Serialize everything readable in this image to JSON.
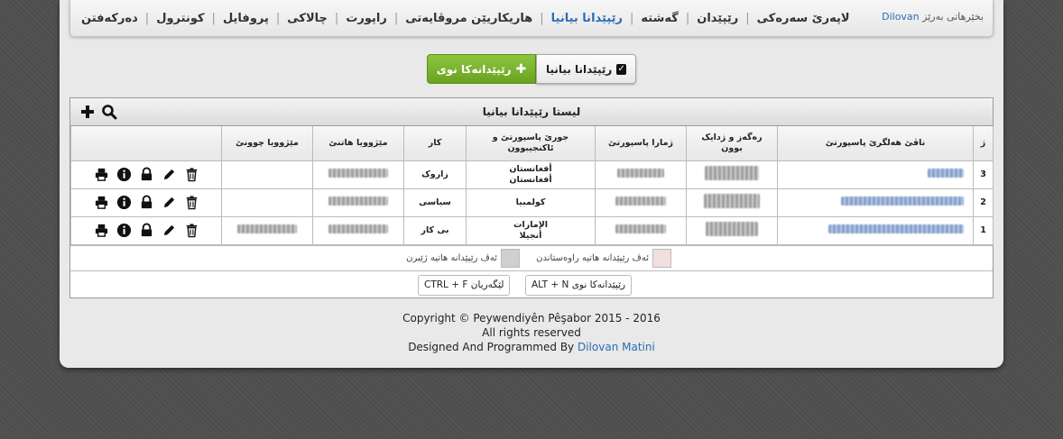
{
  "nav": {
    "items": [
      {
        "label": "لاپەرێ سەرەکی",
        "active": false
      },
      {
        "label": "رێپێدان",
        "active": false
      },
      {
        "label": "گەشتە",
        "active": false
      },
      {
        "label": "رێپێدانا بیانیا",
        "active": true
      },
      {
        "label": "هاریکاریێن مروڤایەتی",
        "active": false
      },
      {
        "label": "راپورت",
        "active": false
      },
      {
        "label": "چالاکی",
        "active": false
      },
      {
        "label": "پروفایل",
        "active": false
      },
      {
        "label": "کونترول",
        "active": false
      },
      {
        "label": "دەرکەفتن",
        "active": false
      }
    ],
    "welcome_text": "بخێرهاتی بەرێز",
    "user_name": "Dilovan"
  },
  "actions": {
    "foreign_button": "رێپێدانا بیانیا",
    "new_button": "رێپێدانەکا نوی"
  },
  "table": {
    "title": "لیستا رێپێدانا بیانیا",
    "headers": {
      "num": "ژ",
      "name": "ناڤێ هەلگرێ پاسپورتێ",
      "nationality": "رەگەز و ژدایک بوون",
      "passport": "ژمارا پاسپورتێ",
      "type": "جورێ پاسپورتێ و ئاکنجیبوون",
      "job": "کار",
      "arrival": "مێژوویا هاتنێ",
      "departure": "مێژوویا چوونێ"
    },
    "rows": [
      {
        "num": "3",
        "country1": "أفغانستان",
        "country2": "أفغانستان",
        "job": "زاروک"
      },
      {
        "num": "2",
        "country1": "کولمبیا",
        "country2": "",
        "job": "سیاسی"
      },
      {
        "num": "1",
        "country1": "الإمارات",
        "country2": "أنجيلا",
        "job": "بی کار"
      }
    ]
  },
  "legend": {
    "rejected": "ئەڤ رێپێدانە هاتیە راوەستاندن",
    "deleted": "ئەڤ رێپێدانە هاتیە ژێبرن",
    "rejected_color": "#f3dede",
    "deleted_color": "#cfcfcf"
  },
  "shortcuts": {
    "new_keys": "ALT + N",
    "new_label": "رێپێدانەکا نوی",
    "search_keys": "CTRL + F",
    "search_label": "لێگەریان"
  },
  "footer": {
    "line1": "Copyright © Peywendiyên Pêşabor 2015 - 2016",
    "line2": "All rights reserved",
    "line3_prefix": "Designed And Programmed By",
    "author": "Dilovan Matini"
  },
  "colors": {
    "accent": "#2a6cb4",
    "green": "#7cb733"
  }
}
